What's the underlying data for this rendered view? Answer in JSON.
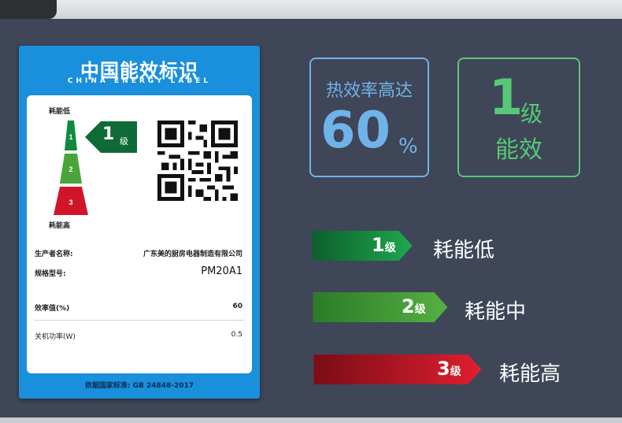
{
  "label": {
    "title": "中国能效标识",
    "subtitle": "CHINA  ENERGY  LABEL",
    "low_text": "耗能低",
    "high_text": "耗能高",
    "grades": [
      "1",
      "2",
      "3"
    ],
    "arrow_number": "1",
    "arrow_unit": "级",
    "producer_label": "生产者名称:",
    "producer_value": "广东美的厨房电器制造有限公司",
    "model_label": "规格型号:",
    "model_value": "PM20A1",
    "efficiency_label": "效率值(%)",
    "efficiency_value": "60",
    "standby_label": "关机功率(W)",
    "standby_value": "0.5",
    "standard_label": "依据国家标准: GB 24848-2017"
  },
  "promo": {
    "thermal_title": "热效率高达",
    "thermal_value": "60",
    "thermal_unit": "%",
    "level_number": "1",
    "level_unit": "级",
    "level_text": "能效"
  },
  "grades": [
    {
      "number": "1",
      "unit": "级",
      "text": "耗能低",
      "color": "#0e8a3c"
    },
    {
      "number": "2",
      "unit": "级",
      "text": "耗能中",
      "color": "#3f9e33"
    },
    {
      "number": "3",
      "unit": "级",
      "text": "耗能高",
      "color": "#c1121f"
    }
  ],
  "colors": {
    "background": "#3f4657",
    "label_blue": "#1a8fdc",
    "promo_blue": "#6fb3e8",
    "promo_green": "#57c878"
  }
}
